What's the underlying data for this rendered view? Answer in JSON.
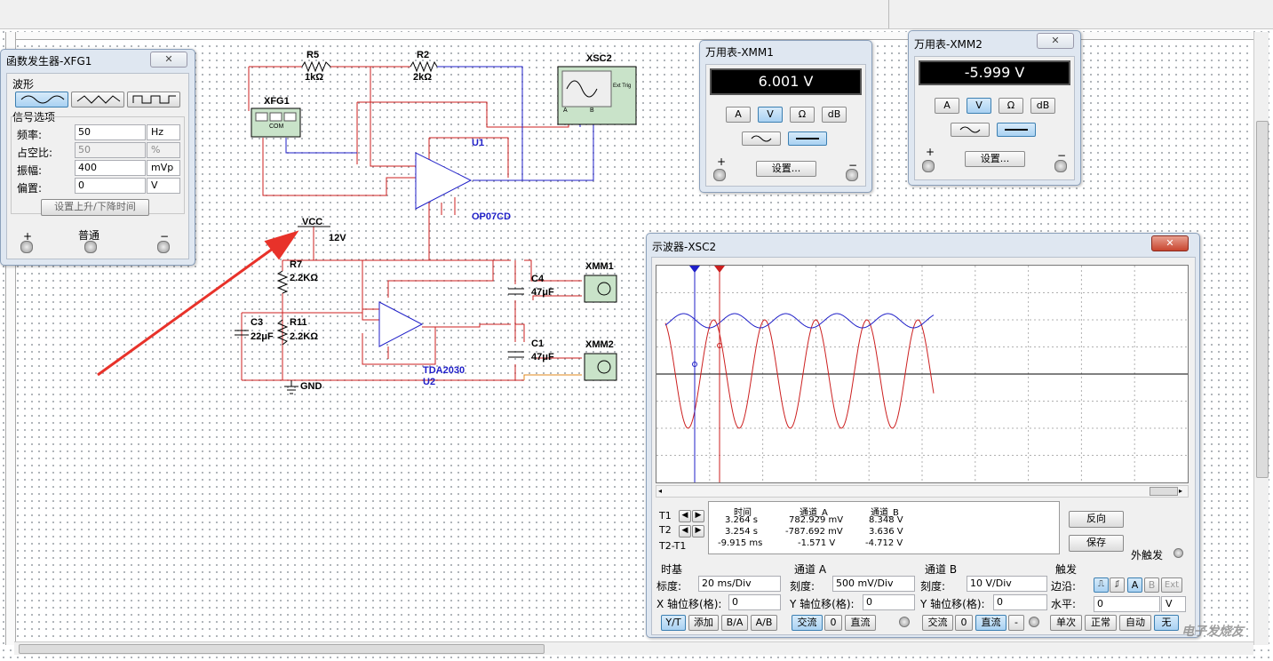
{
  "schematic": {
    "components": {
      "R5": {
        "name": "R5",
        "value": "1kΩ"
      },
      "R2": {
        "name": "R2",
        "value": "2kΩ"
      },
      "XSC2": {
        "name": "XSC2",
        "ext_trig": "Ext Trig",
        "ch_a": "A",
        "ch_b": "B"
      },
      "XFG1": {
        "name": "XFG1",
        "com": "COM"
      },
      "U1": {
        "name": "U1",
        "part": "OP07CD"
      },
      "VCC": {
        "name": "VCC",
        "value": "12V"
      },
      "R7": {
        "name": "R7",
        "value": "2.2KΩ"
      },
      "C3": {
        "name": "C3",
        "value": "22μF"
      },
      "R11": {
        "name": "R11",
        "value": "2.2KΩ"
      },
      "U2": {
        "name": "U2",
        "part": "TDA2030"
      },
      "GND": {
        "name": "GND"
      },
      "C4": {
        "name": "C4",
        "value": "47μF"
      },
      "C1": {
        "name": "C1",
        "value": "47μF"
      },
      "XMM1": {
        "name": "XMM1"
      },
      "XMM2": {
        "name": "XMM2"
      }
    },
    "colors": {
      "red_wire": "#cc1f1f",
      "blue_wire": "#1f1fc8",
      "orange_wire": "#e08a1e",
      "part_fill": "#c9e3c9"
    }
  },
  "fg_window": {
    "title": "函数发生器-XFG1",
    "waveform_label": "波形",
    "signal_options_label": "信号选项",
    "rows": [
      {
        "label": "频率:",
        "value": "50",
        "unit": "Hz"
      },
      {
        "label": "占空比:",
        "value": "50",
        "unit": "%"
      },
      {
        "label": "振幅:",
        "value": "400",
        "unit": "mVp"
      },
      {
        "label": "偏置:",
        "value": "0",
        "unit": "V"
      }
    ],
    "rise_fall_button": "设置上升/下降时间",
    "plus": "+",
    "common": "普通",
    "minus": "−"
  },
  "mm1_window": {
    "title": "万用表-XMM1",
    "reading": "6.001 V",
    "buttons": [
      "A",
      "V",
      "Ω",
      "dB"
    ],
    "settings_button": "设置...",
    "plus": "+",
    "minus": "−"
  },
  "mm2_window": {
    "title": "万用表-XMM2",
    "reading": "-5.999 V",
    "buttons": [
      "A",
      "V",
      "Ω",
      "dB"
    ],
    "settings_button": "设置...",
    "plus": "+",
    "minus": "−"
  },
  "scope_window": {
    "title": "示波器-XSC2",
    "close_glyph": "✕",
    "cursor_table": {
      "headers": [
        "时间",
        "通道_A",
        "通道_B"
      ],
      "rows": [
        {
          "label": "T1",
          "time": "3.264 s",
          "ch_a": "782.929 mV",
          "ch_b": "8.348 V"
        },
        {
          "label": "T2",
          "time": "3.254 s",
          "ch_a": "-787.692 mV",
          "ch_b": "3.636 V"
        },
        {
          "label": "T2-T1",
          "time": "-9.915 ms",
          "ch_a": "-1.571 V",
          "ch_b": "-4.712 V"
        }
      ]
    },
    "reverse_button": "反向",
    "save_button": "保存",
    "ext_trigger_label": "外触发",
    "timebase": {
      "header": "时基",
      "scale_label": "标度:",
      "scale_value": "20 ms/Div",
      "xpos_label": "X 轴位移(格):",
      "xpos_value": "0",
      "buttons": [
        "Y/T",
        "添加",
        "B/A",
        "A/B"
      ]
    },
    "channel_a": {
      "header": "通道 A",
      "scale_label": "刻度:",
      "scale_value": "500 mV/Div",
      "ypos_label": "Y 轴位移(格):",
      "ypos_value": "0",
      "buttons": [
        "交流",
        "0",
        "直流"
      ]
    },
    "channel_b": {
      "header": "通道 B",
      "scale_label": "刻度:",
      "scale_value": "10 V/Div",
      "ypos_label": "Y 轴位移(格):",
      "ypos_value": "0",
      "buttons": [
        "交流",
        "0",
        "直流",
        "-"
      ]
    },
    "trigger": {
      "header": "触发",
      "edge_label": "边沿:",
      "edge_buttons": [
        "A",
        "B",
        "Ext"
      ],
      "level_label": "水平:",
      "level_value": "0",
      "level_unit": "V",
      "mode_buttons": [
        "单次",
        "正常",
        "自动",
        "无"
      ]
    },
    "trace_colors": {
      "channel_a": "#1f1fc8",
      "channel_b": "#cc1f1f"
    }
  },
  "watermark": "电子发烧友"
}
